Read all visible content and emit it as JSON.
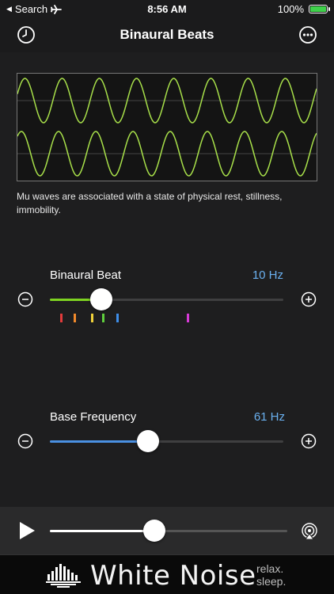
{
  "status_bar": {
    "back_label": "Search",
    "time": "8:56 AM",
    "battery": "100%"
  },
  "nav": {
    "title": "Binaural Beats",
    "left_icon": "clock-icon",
    "right_icon": "more-icon"
  },
  "description": "Mu waves are associated with a state of physical rest, stillness, immobility.",
  "binaural_beat": {
    "label": "Binaural Beat",
    "value": "10 Hz",
    "fill_fraction": 0.22,
    "fill_color": "#7ed321"
  },
  "band_markers": [
    {
      "color": "#e23b3b",
      "fraction": 0.045
    },
    {
      "color": "#f28a2b",
      "fraction": 0.1
    },
    {
      "color": "#f0d23a",
      "fraction": 0.175
    },
    {
      "color": "#5fcf3d",
      "fraction": 0.225
    },
    {
      "color": "#3e8ee8",
      "fraction": 0.285
    },
    {
      "color": "#d63ad6",
      "fraction": 0.585
    }
  ],
  "base_frequency": {
    "label": "Base Frequency",
    "value": "61 Hz",
    "fill_fraction": 0.42,
    "fill_color": "#4a90e2"
  },
  "player": {
    "progress_fraction": 0.44
  },
  "banner": {
    "title": "White Noise",
    "tagline_line1": "relax.",
    "tagline_line2": "sleep."
  },
  "colors": {
    "wave": "#a8e04a",
    "accent_value": "#6ab0ef"
  }
}
